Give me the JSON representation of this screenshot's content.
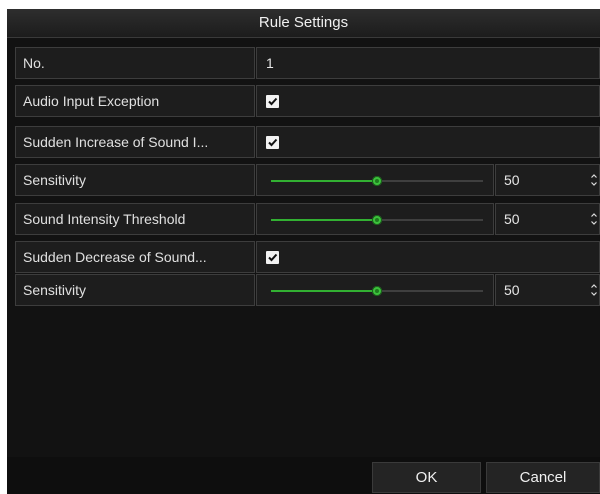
{
  "dialog": {
    "title": "Rule Settings"
  },
  "rows": [
    {
      "label": "No.",
      "value": "1"
    },
    {
      "label": "Audio Input Exception",
      "checked": true
    },
    {
      "label": "Sudden Increase of Sound I...",
      "checked": true
    },
    {
      "label": "Sensitivity",
      "slider_level_percent": 50,
      "number": "50"
    },
    {
      "label": "Sound Intensity Threshold",
      "slider_level_percent": 50,
      "number": "50"
    },
    {
      "label": "Sudden Decrease of Sound...",
      "checked": true
    },
    {
      "label": "Sensitivity",
      "slider_level_percent": 50,
      "number": "50"
    }
  ],
  "buttons": {
    "ok": "OK",
    "cancel": "Cancel"
  },
  "colors": {
    "background": "#121212",
    "accent": "#32b032",
    "text": "#e6e6e6"
  }
}
